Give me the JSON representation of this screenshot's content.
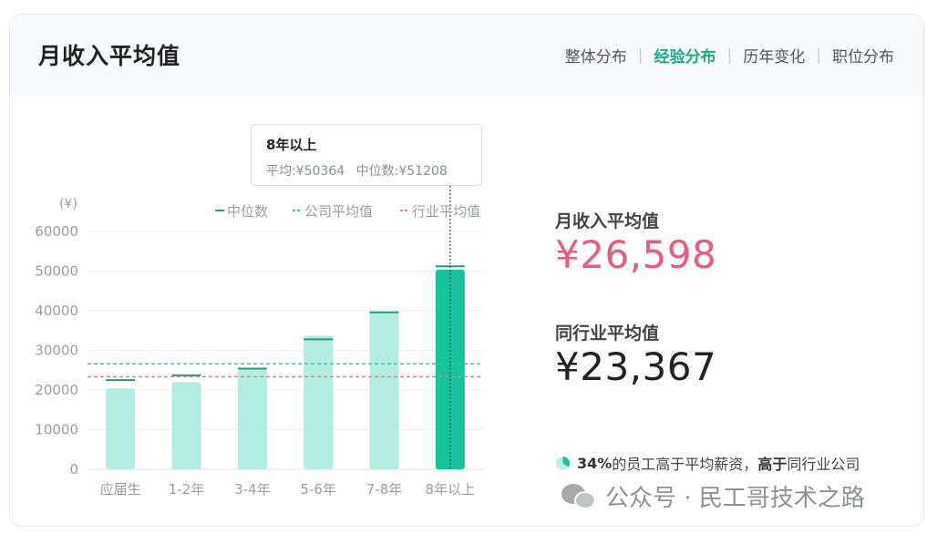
{
  "header": {
    "title": "月收入平均值",
    "tabs": [
      {
        "label": "整体分布",
        "active": false
      },
      {
        "label": "经验分布",
        "active": true
      },
      {
        "label": "历年变化",
        "active": false
      },
      {
        "label": "职位分布",
        "active": false
      }
    ]
  },
  "tooltip": {
    "title": "8年以上",
    "avg": "平均:¥50364",
    "median": "中位数:¥51208"
  },
  "chart_data": {
    "type": "bar",
    "ylabel": "(¥)",
    "ylim": [
      0,
      60000
    ],
    "yticks": [
      0,
      10000,
      20000,
      30000,
      40000,
      50000,
      60000
    ],
    "ytick_labels": [
      "0",
      "10000",
      "20000",
      "30000",
      "40000",
      "50000",
      "60000"
    ],
    "categories": [
      "应届生",
      "1-2年",
      "3-4年",
      "5-6年",
      "7-8年",
      "8年以上"
    ],
    "values": [
      20400,
      22000,
      25200,
      33700,
      39800,
      50364
    ],
    "medians": [
      22500,
      23700,
      25400,
      32800,
      39600,
      51208
    ],
    "highlighted_index": 5,
    "legend": [
      "中位数",
      "公司平均值",
      "行业平均值"
    ],
    "company_avg": 26598,
    "industry_avg": 23367,
    "colors": {
      "bar": "#b3ece0",
      "bar_highlight": "#16c29c",
      "median": "#1f9e7f",
      "company_avg": "#2fcfa6",
      "industry_avg": "#f07a8c",
      "tick_text": "#9a9da4",
      "grid": "#eef0f3"
    }
  },
  "summary": {
    "avg_label": "月收入平均值",
    "avg_value": "¥26,598",
    "avg_color": "#ee5a7b",
    "industry_label": "同行业平均值",
    "industry_value": "¥23,367",
    "industry_color": "#222222"
  },
  "footnote": {
    "percent": "34%",
    "text1": "的员工高于平均薪资，",
    "bold2": "高于",
    "text2": "同行业公司",
    "icon": "pie-chart-icon"
  },
  "watermark": {
    "text": "公众号 · 民工哥技术之路",
    "icon": "wechat-icon"
  }
}
